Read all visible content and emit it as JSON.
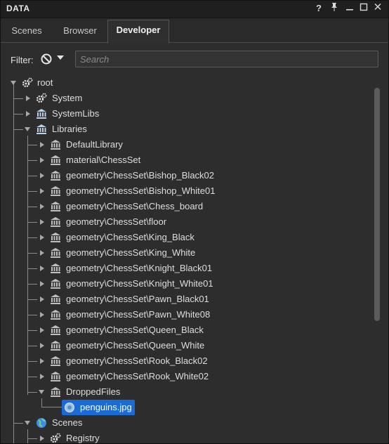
{
  "window": {
    "title": "DATA",
    "buttons": [
      "?",
      "pin",
      "minimize",
      "maximize",
      "close"
    ]
  },
  "tabs": [
    {
      "label": "Scenes",
      "active": false
    },
    {
      "label": "Browser",
      "active": false
    },
    {
      "label": "Developer",
      "active": true
    }
  ],
  "filter": {
    "label": "Filter:",
    "search_placeholder": "Search",
    "search_value": ""
  },
  "tree": {
    "root": {
      "label": "root",
      "icon": "gears-icon"
    },
    "system": {
      "label": "System",
      "icon": "gears-icon"
    },
    "systemlibs": {
      "label": "SystemLibs",
      "icon": "library-icon"
    },
    "libraries": {
      "label": "Libraries",
      "icon": "library-icon"
    },
    "library_items": [
      "DefaultLibrary",
      "material\\ChessSet",
      "geometry\\ChessSet\\Bishop_Black02",
      "geometry\\ChessSet\\Bishop_White01",
      "geometry\\ChessSet\\Chess_board",
      "geometry\\ChessSet\\floor",
      "geometry\\ChessSet\\King_Black",
      "geometry\\ChessSet\\King_White",
      "geometry\\ChessSet\\Knight_Black01",
      "geometry\\ChessSet\\Knight_White01",
      "geometry\\ChessSet\\Pawn_Black01",
      "geometry\\ChessSet\\Pawn_White08",
      "geometry\\ChessSet\\Queen_Black",
      "geometry\\ChessSet\\Queen_White",
      "geometry\\ChessSet\\Rook_Black02",
      "geometry\\ChessSet\\Rook_White02"
    ],
    "dropped_files": {
      "label": "DroppedFiles",
      "icon": "library-icon"
    },
    "dropped_item": {
      "label": "penguins.jpg",
      "icon": "image-file-icon",
      "selected": true
    },
    "scenes": {
      "label": "Scenes",
      "icon": "globe-icon"
    },
    "registry": {
      "label": "Registry",
      "icon": "gears-icon"
    }
  },
  "colors": {
    "selection": "#1a6bd6",
    "background": "#2d2d2d",
    "text": "#dedede"
  }
}
